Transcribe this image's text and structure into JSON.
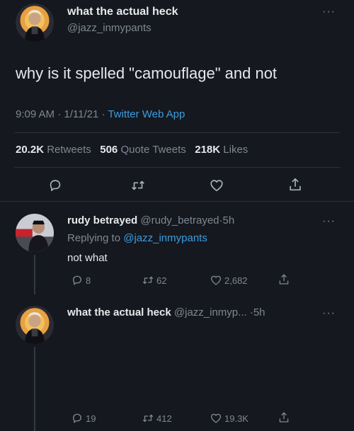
{
  "main_tweet": {
    "display_name": "what the actual heck",
    "handle": "@jazz_inmypants",
    "text": "why is it spelled \"camouflage\" and not",
    "time": "9:09 AM",
    "date": "1/11/21",
    "source": "Twitter Web App",
    "separator": "·",
    "stats": {
      "retweets": "20.2K",
      "retweets_label": "Retweets",
      "quotes": "506",
      "quotes_label": "Quote Tweets",
      "likes": "218K",
      "likes_label": "Likes"
    },
    "more": "···"
  },
  "reply1": {
    "display_name": "rudy betrayed",
    "handle": "@rudy_betrayed",
    "age": "5h",
    "separator": "·",
    "replying_to_label": "Replying to",
    "replying_to_handle": "@jazz_inmypants",
    "text": "not what",
    "replies": "8",
    "retweets": "62",
    "likes": "2,682",
    "more": "···"
  },
  "reply2": {
    "display_name": "what the actual heck",
    "handle": "@jazz_inmyp...",
    "age": "5h",
    "separator": "·",
    "replies": "19",
    "retweets": "412",
    "likes": "19.3K",
    "more": "···"
  },
  "icons": {
    "reply": "reply-icon",
    "retweet": "retweet-icon",
    "like": "heart-icon",
    "share": "share-icon"
  },
  "colors": {
    "background": "#15181f",
    "text": "#e7e9ea",
    "muted": "#7f8791",
    "link": "#3b9de0"
  }
}
